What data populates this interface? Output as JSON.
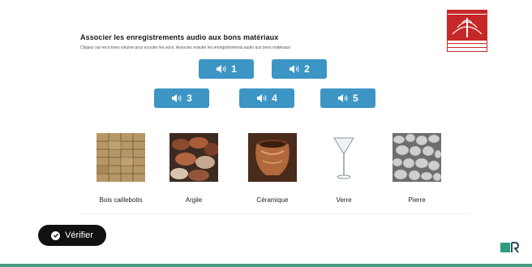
{
  "exercise": {
    "title": "Associer les enregistrements audio aux bons matériaux",
    "instructions": "Cliquez sur les icônes volume pour écouter les sons. Associez ensuite les enregistrements audio aux bons matériaux"
  },
  "audio_buttons": [
    {
      "number": "1",
      "icon": "volume-icon"
    },
    {
      "number": "2",
      "icon": "volume-icon"
    },
    {
      "number": "3",
      "icon": "volume-icon"
    },
    {
      "number": "4",
      "icon": "volume-icon"
    },
    {
      "number": "5",
      "icon": "volume-icon"
    }
  ],
  "materials": [
    {
      "label": "Bois caillebotis"
    },
    {
      "label": "Argile"
    },
    {
      "label": "Céramique"
    },
    {
      "label": "Verre"
    },
    {
      "label": "Pierre"
    }
  ],
  "verify_button": {
    "label": "Vérifier",
    "icon": "check-circle-icon"
  },
  "colors": {
    "audio_button": "#3c95c4",
    "logo_red": "#c62828",
    "verify_button": "#111111",
    "footer": "#4a9a86",
    "brand_teal": "#2f9b7f"
  }
}
